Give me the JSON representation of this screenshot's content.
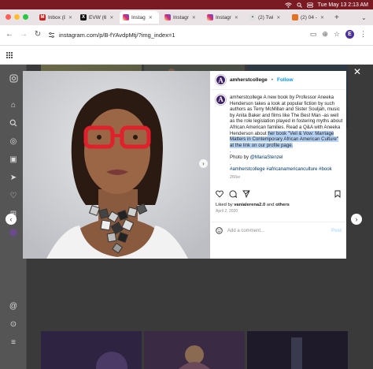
{
  "menubar": {
    "clock": "Tue May 13  2:13 AM"
  },
  "tabs": [
    {
      "label": "Inbox (8",
      "fav_bg": "#c5221f",
      "fav": "M"
    },
    {
      "label": "EVW (6",
      "fav_bg": "#111111",
      "fav": "X"
    },
    {
      "label": "Instag",
      "fav_bg": "#d62976",
      "fav": "",
      "active": true
    },
    {
      "label": "Instagr",
      "fav_bg": "#d62976",
      "fav": ""
    },
    {
      "label": "Instagr",
      "fav_bg": "#d62976",
      "fav": ""
    },
    {
      "label": "(2) Twi",
      "fav_bg": "#e8e8e8",
      "fav": ""
    },
    {
      "label": "(2) 04 -",
      "fav_bg": "#e37222",
      "fav": ""
    }
  ],
  "toolbar": {
    "url": "instagram.com/p/B-fYAvdpMtj/?img_index=1",
    "profile_initial": "E"
  },
  "post": {
    "username": "amherstcollege",
    "follow": "Follow",
    "caption_a": "amherstcollege A new book by Professor Aneeka Henderson takes a look at popular fiction by such authors as Terry McMillan and Sister Souljah, music by Anita Baker and films like The Best Man -as well as the role legislation played in fostering myths about African American families. Read a Q&A with Aneeka Henderson about ",
    "caption_hl": "her book \"Veil & Vow: Marriage Matters in Contemporary African American Culture\" at the link on our profile page.",
    "caption_dot": ".",
    "photo_by_label": "Photo by ",
    "photo_by_handle": "@MariaStenzel",
    "hashtags": "#amherstcollege #africanamericanculture #book",
    "age": "266w",
    "liked_by_prefix": "Liked by ",
    "liked_by_user": "vanialerena2.0",
    "liked_by_suffix": " and ",
    "liked_by_others": "others",
    "date": "April 2, 2020",
    "comment_placeholder": "Add a comment...",
    "post_button": "Post"
  },
  "colors": {
    "accent": "#0095f6",
    "highlight": "#b6d3f5",
    "logo_purple": "#3f1f69",
    "menubar": "#7a1a22"
  },
  "icons": [
    "home-icon",
    "search-icon",
    "explore-icon",
    "reels-icon",
    "messages-icon",
    "notifications-icon",
    "create-icon",
    "profile-icon",
    "threads-icon",
    "more-icon"
  ]
}
